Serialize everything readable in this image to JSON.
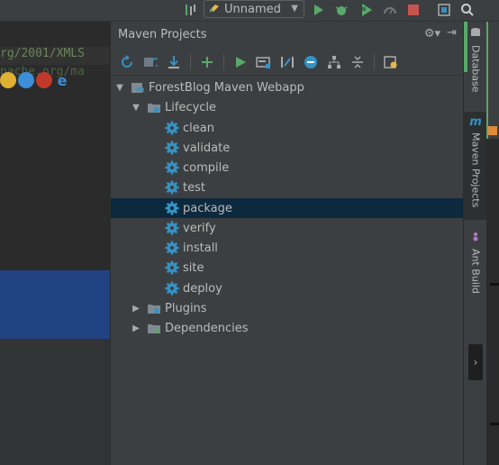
{
  "toolbar": {
    "run_config_label": "Unnamed"
  },
  "editor": {
    "line1": "rg/2001/XMLS",
    "line2": "pache.org/ma"
  },
  "panel": {
    "title": "Maven Projects"
  },
  "tree": {
    "project": "ForestBlog Maven Webapp",
    "lifecycle": "Lifecycle",
    "goals": [
      "clean",
      "validate",
      "compile",
      "test",
      "package",
      "verify",
      "install",
      "site",
      "deploy"
    ],
    "selected_goal": "package",
    "plugins": "Plugins",
    "dependencies": "Dependencies"
  },
  "side_tabs": {
    "database": "Database",
    "maven": "Maven Projects",
    "ant": "Ant Build"
  },
  "colors": {
    "run_green": "#59a869",
    "debug_green": "#59a869",
    "stop_red": "#c75450",
    "gear_blue": "#3592c4",
    "selection": "#0d293e",
    "editor_selection": "#214283"
  }
}
